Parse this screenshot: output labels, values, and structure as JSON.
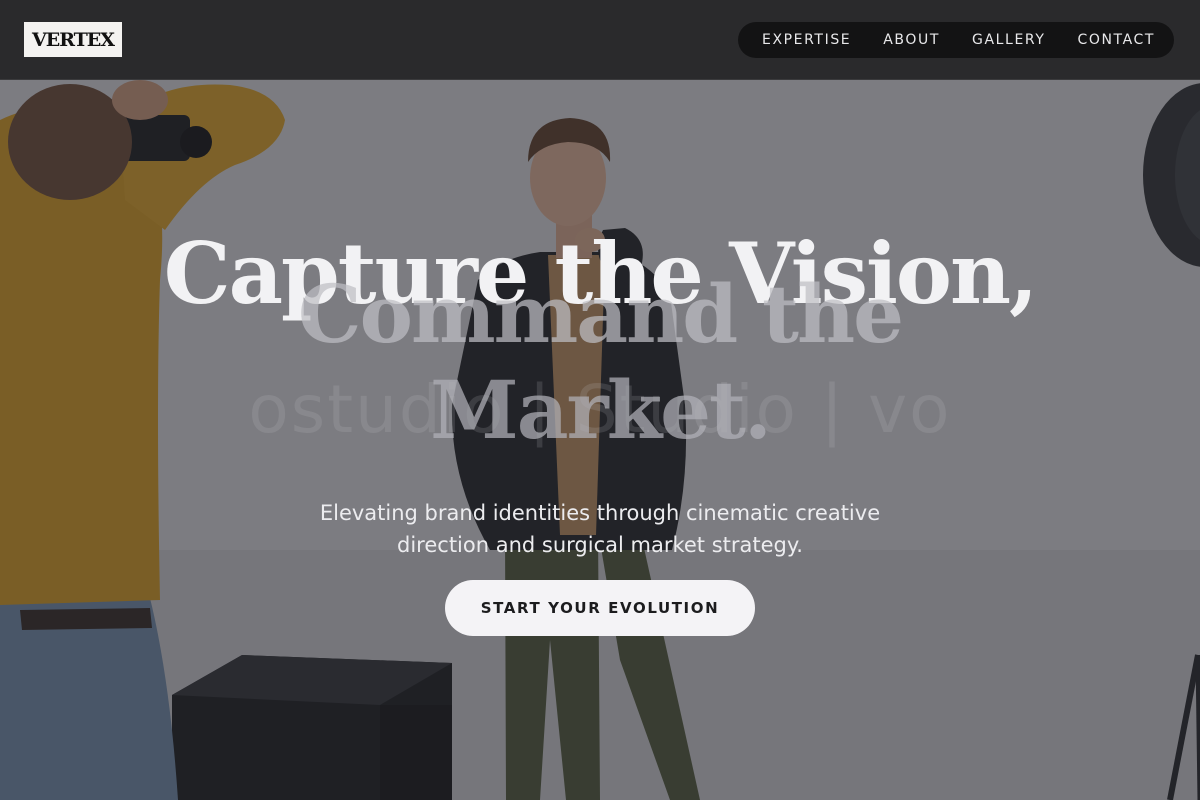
{
  "brand": {
    "logo_text": "VERTEX"
  },
  "nav": {
    "items": [
      {
        "label": "EXPERTISE"
      },
      {
        "label": "ABOUT"
      },
      {
        "label": "GALLERY"
      },
      {
        "label": "CONTACT"
      }
    ]
  },
  "hero": {
    "headline_line1": "Capture the Vision,",
    "headline_line2": "Command the",
    "headline_line3": "Market.",
    "ghost_text": "ostudio | Studio | vo",
    "subtitle": "Elevating brand identities through cinematic creative direction and surgical market strategy.",
    "cta_label": "START YOUR EVOLUTION"
  },
  "colors": {
    "header_bg": "#2a2a2c",
    "nav_pill_bg": "#131314",
    "cta_bg": "#f4f3f6",
    "headline_primary": "#f2f2f4",
    "accent_sweater": "#d49a1e"
  }
}
